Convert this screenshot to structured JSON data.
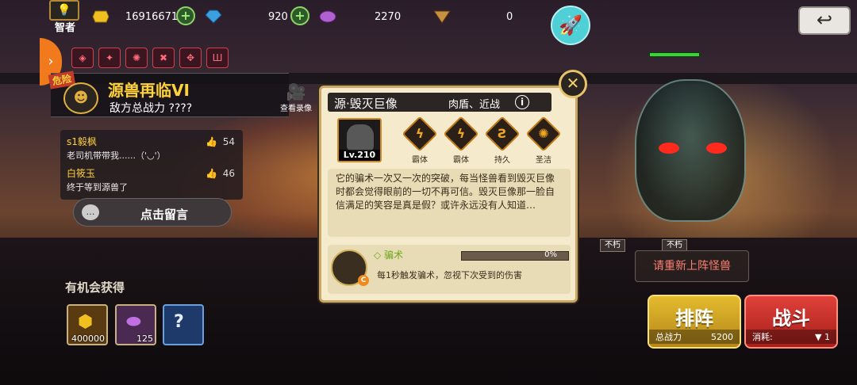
{
  "topbar": {
    "rank_label": "智者",
    "gold": "16916671",
    "gems": "920",
    "stones": "2270",
    "tokens": "0",
    "colors": {
      "gold": "#f0c020",
      "gem": "#3aa0e0",
      "stone": "#b060d0",
      "rocket": "#4fd0d6"
    }
  },
  "dungeon": {
    "danger_label": "危险",
    "boss_name": "源兽再临VI",
    "enemy_power": "敌方总战力 ????",
    "replay_label": "查看录像"
  },
  "comments": [
    {
      "user": "s1毅枫",
      "text": "老司机带带我......（'◡'）",
      "likes": "54"
    },
    {
      "user": "白筱玉",
      "text": "终于等到源兽了",
      "likes": "46"
    }
  ],
  "message_button": {
    "label": "点击留言"
  },
  "rewards": {
    "title": "有机会获得",
    "items": [
      {
        "icon": "gold-pile-icon",
        "qty": "400000"
      },
      {
        "icon": "purple-stone-icon",
        "qty": "125"
      },
      {
        "icon": "mystery-box-icon",
        "qty": ""
      }
    ]
  },
  "monster_card": {
    "name": "源·毁灭巨像",
    "role": "肉盾、近战",
    "level": "Lv.210",
    "traits": [
      "霸体",
      "霸体",
      "持久",
      "圣洁"
    ],
    "description": "它的骗术一次又一次的突破，每当怪兽看到毁灭巨像时都会觉得眼前的一切不再可信。毁灭巨像那一脸自信满足的笑容是真是假？或许永远没有人知道…",
    "skill": {
      "name": "骗术",
      "progress_label": "0%",
      "progress": 0,
      "grade": "C",
      "description": "每1秒触发骗术，忽视下次受到的伤害"
    }
  },
  "tags": [
    "不朽",
    "不朽"
  ],
  "hint": "请重新上阵怪兽",
  "formation_button": {
    "label": "排阵",
    "sub_label": "总战力",
    "sub_value": "5200"
  },
  "battle_button": {
    "label": "战斗",
    "sub_label": "消耗:",
    "sub_value": "▼ 1"
  }
}
